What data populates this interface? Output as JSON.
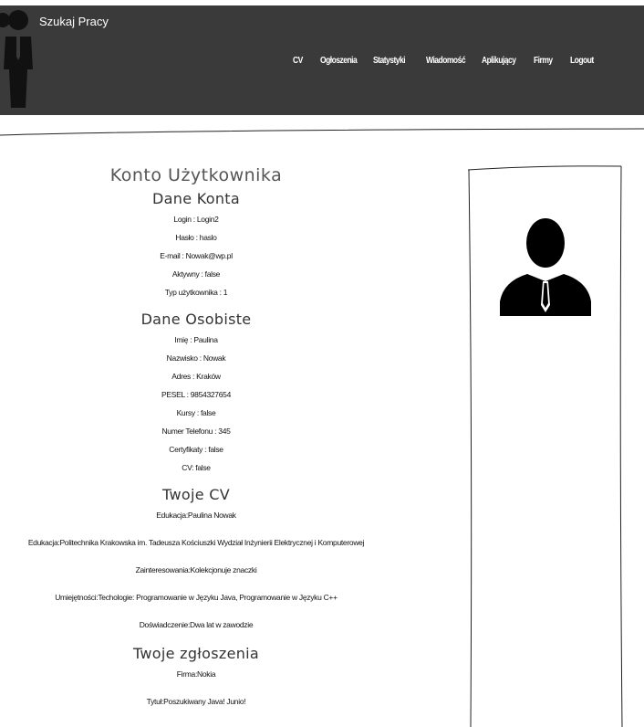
{
  "header": {
    "brand": "Szukaj Pracy",
    "nav": [
      "CV",
      "Ogłoszenia",
      "Statystyki",
      "Wiadomość",
      "Aplikujący",
      "Firmy",
      "Logout"
    ],
    "background_color": "#3a3a3a"
  },
  "account": {
    "title": "Konto Użytkownika",
    "section_account": "Dane Konta",
    "login": "Login : Login2",
    "password": "Hasło : haslo",
    "email": "E-mail : Nowak@wp.pl",
    "active": "Aktywny : false",
    "user_type": "Typ użytkownika : 1"
  },
  "personal": {
    "section": "Dane Osobiste",
    "first_name": "Imię : Paulina",
    "last_name": "Nazwisko : Nowak",
    "address": "Adres : Kraków",
    "pesel": "PESEL : 9854327654",
    "courses": "Kursy : false",
    "phone": "Numer Telefonu : 345",
    "certificates": "Certyfikaty : false",
    "cv": "CV: false"
  },
  "cv": {
    "section": "Twoje CV",
    "name": "Edukacja:Paulina Nowak",
    "education": "Edukacja:Politechnika Krakowska im. Tadeusza Kościuszki Wydział Inżynierii Elektrycznej i Komputerowej",
    "interests": "Zainteresowania:Kolekcjonuje znaczki",
    "skills": "Umiejętności:Techologie: Programowanie w Języku Java, Programowanie w Języku C++",
    "experience": "Doświadczenie:Dwa lat w zawodzie"
  },
  "applications": {
    "section": "Twoje zgłoszenia",
    "company": "Firma:Nokia",
    "title": "Tytuł:Poszukiwany Java! Junio!"
  },
  "profile_picture_icon": "user-avatar-icon"
}
